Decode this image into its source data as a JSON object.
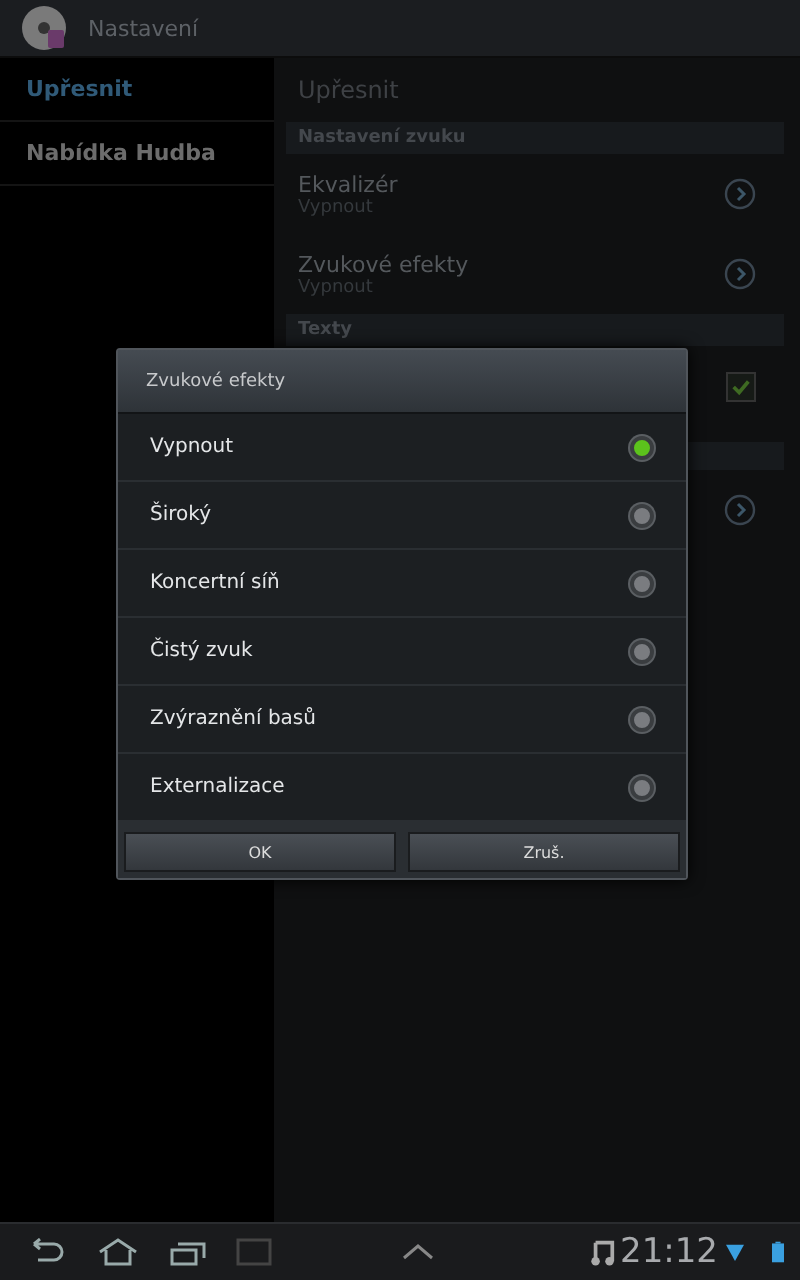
{
  "app_bar": {
    "title": "Nastavení"
  },
  "sidebar": {
    "items": [
      {
        "label": "Upřesnit",
        "selected": true
      },
      {
        "label": "Nabídka Hudba",
        "selected": false
      }
    ]
  },
  "content": {
    "title": "Upřesnit",
    "sections": [
      {
        "header": "Nastavení zvuku",
        "rows": [
          {
            "kind": "link",
            "title": "Ekvalizér",
            "summary": "Vypnout"
          },
          {
            "kind": "link",
            "title": "Zvukové efekty",
            "summary": "Vypnout"
          }
        ]
      },
      {
        "header": "Texty",
        "rows": [
          {
            "kind": "checkbox",
            "checked": true
          }
        ]
      },
      {
        "rows": [
          {
            "kind": "link"
          }
        ]
      }
    ]
  },
  "dialog": {
    "title": "Zvukové efekty",
    "options": [
      {
        "label": "Vypnout",
        "selected": true
      },
      {
        "label": "Široký",
        "selected": false
      },
      {
        "label": "Koncertní síň",
        "selected": false
      },
      {
        "label": "Čistý zvuk",
        "selected": false
      },
      {
        "label": "Zvýraznění basů",
        "selected": false
      },
      {
        "label": "Externalizace",
        "selected": false
      }
    ],
    "buttons": [
      "OK",
      "Zruš."
    ]
  },
  "status_bar": {
    "time": "21:12"
  }
}
